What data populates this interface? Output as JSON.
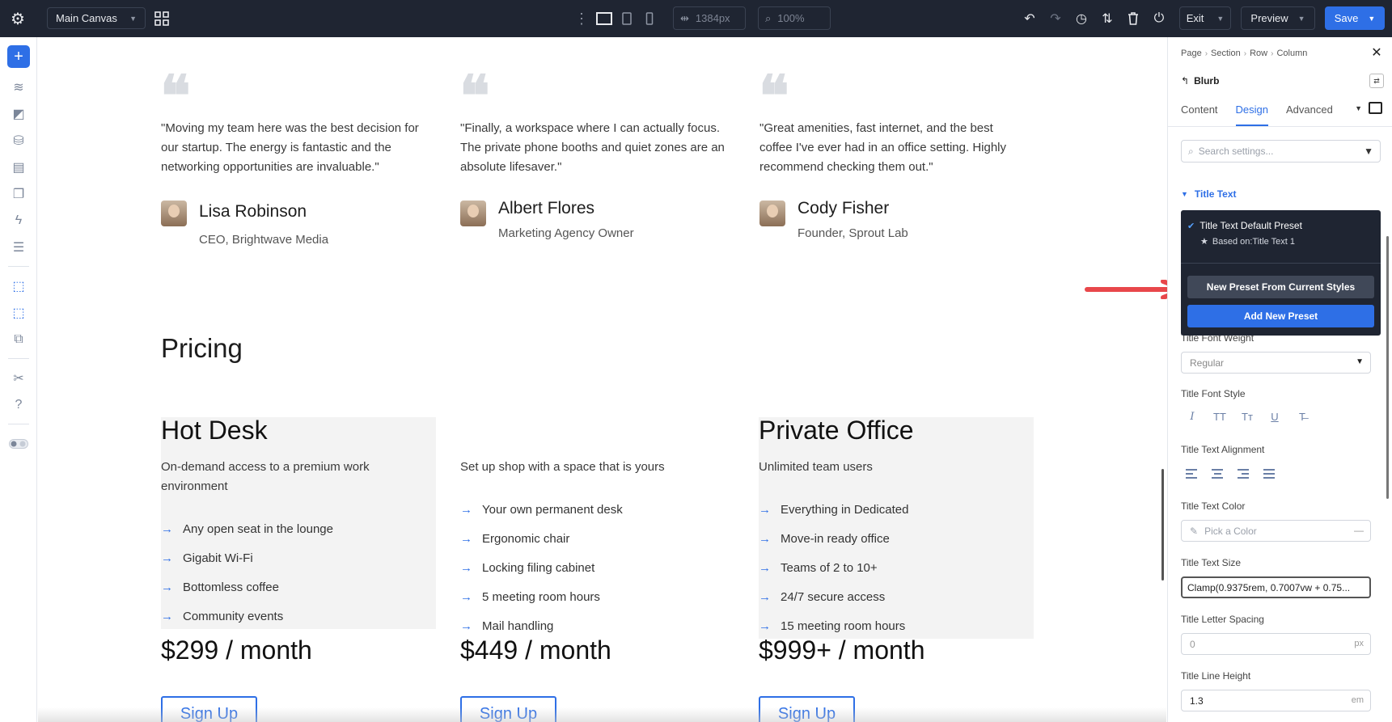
{
  "topbar": {
    "canvas_name": "Main Canvas",
    "width_value": "1384px",
    "zoom_value": "100%",
    "exit_label": "Exit",
    "preview_label": "Preview",
    "save_label": "Save"
  },
  "testimonials": [
    {
      "quote": "\"Moving my team here was the best decision for our startup. The energy is fantastic and the networking opportunities are invaluable.\"",
      "name": "Lisa Robinson",
      "role": "CEO, Brightwave Media"
    },
    {
      "quote": "\"Finally, a workspace where I can actually focus. The private phone booths and quiet zones are an absolute lifesaver.\"",
      "name": "Albert Flores",
      "role": "Marketing Agency Owner"
    },
    {
      "quote": "\"Great amenities, fast internet, and the best coffee I've ever had in an office setting. Highly recommend checking them out.\"",
      "name": "Cody Fisher",
      "role": "Founder, Sprout Lab"
    }
  ],
  "pricing": {
    "title": "Pricing",
    "cards": [
      {
        "title": "Hot Desk",
        "desc": "On-demand access to a premium work environment",
        "features": [
          "Any open seat in the lounge",
          "Gigabit Wi-Fi",
          "Bottomless coffee",
          "Community events"
        ],
        "price": "$299 / month",
        "cta": "Sign Up"
      },
      {
        "title": "",
        "desc": "Set up shop with a space that is yours",
        "features": [
          "Your own permanent desk",
          "Ergonomic chair",
          "Locking filing cabinet",
          "5 meeting room hours",
          "Mail handling"
        ],
        "price": "$449 / month",
        "cta": "Sign Up"
      },
      {
        "title": "Private Office",
        "desc": "Unlimited team users",
        "features": [
          "Everything in Dedicated",
          "Move-in ready office",
          "Teams of 2 to 10+",
          "24/7 secure access",
          "15 meeting room hours"
        ],
        "price": "$999+ / month",
        "cta": "Sign Up"
      }
    ]
  },
  "panel": {
    "breadcrumbs": [
      "Page",
      "Section",
      "Row",
      "Column"
    ],
    "module": "Blurb",
    "tabs": [
      "Content",
      "Design",
      "Advanced"
    ],
    "search_placeholder": "Search settings...",
    "group": "Title Text",
    "preset": {
      "current": "Title Text Default Preset",
      "based_on": "Based on:Title Text 1",
      "new_from_current": "New Preset From Current Styles",
      "add_new": "Add New Preset"
    },
    "font_weight_label": "Title Font Weight",
    "font_weight_value": "Regular",
    "font_style_label": "Title Font Style",
    "font_style_options": [
      "I",
      "TT",
      "Tт",
      "U",
      "T̶"
    ],
    "alignment_label": "Title Text Alignment",
    "color_label": "Title Text Color",
    "color_placeholder": "Pick a Color",
    "color_dash": "—",
    "size_label": "Title Text Size",
    "size_value": "Clamp(0.9375rem, 0.7007vw + 0.75...",
    "letter_spacing_label": "Title Letter Spacing",
    "letter_spacing_value": "0",
    "letter_spacing_unit": "px",
    "line_height_label": "Title Line Height",
    "line_height_value": "1.3",
    "line_height_unit": "em"
  },
  "colors": {
    "accent": "#2e6fe6",
    "topbar_bg": "#1f2532",
    "annotation_arrow": "#e8474b"
  }
}
